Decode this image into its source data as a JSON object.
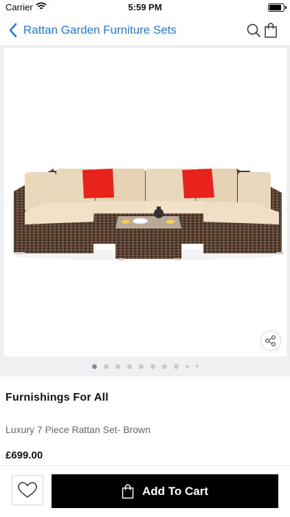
{
  "status_bar": {
    "carrier": "Carrier",
    "time": "5:59 PM",
    "battery_level": 0.95
  },
  "nav": {
    "title": "Rattan Garden Furniture Sets",
    "back_icon": "chevron-left-icon",
    "search_icon": "search-icon",
    "bag_icon": "shopping-bag-icon"
  },
  "gallery": {
    "image": "rattan-sofa-set-photo",
    "page_count": 10,
    "current_page": 1,
    "share_icon": "share-icon"
  },
  "product": {
    "brand": "Furnishings For All",
    "name": "Luxury 7 Piece Rattan Set- Brown",
    "price": "£699.00"
  },
  "actions": {
    "add_to_cart_label": "Add To Cart",
    "wishlist_icon": "heart-icon"
  },
  "colors": {
    "accent": "#1f7ae0",
    "cushion": "#ead8bd",
    "pillow": "#e8231d",
    "rattan": "#5a4234"
  }
}
